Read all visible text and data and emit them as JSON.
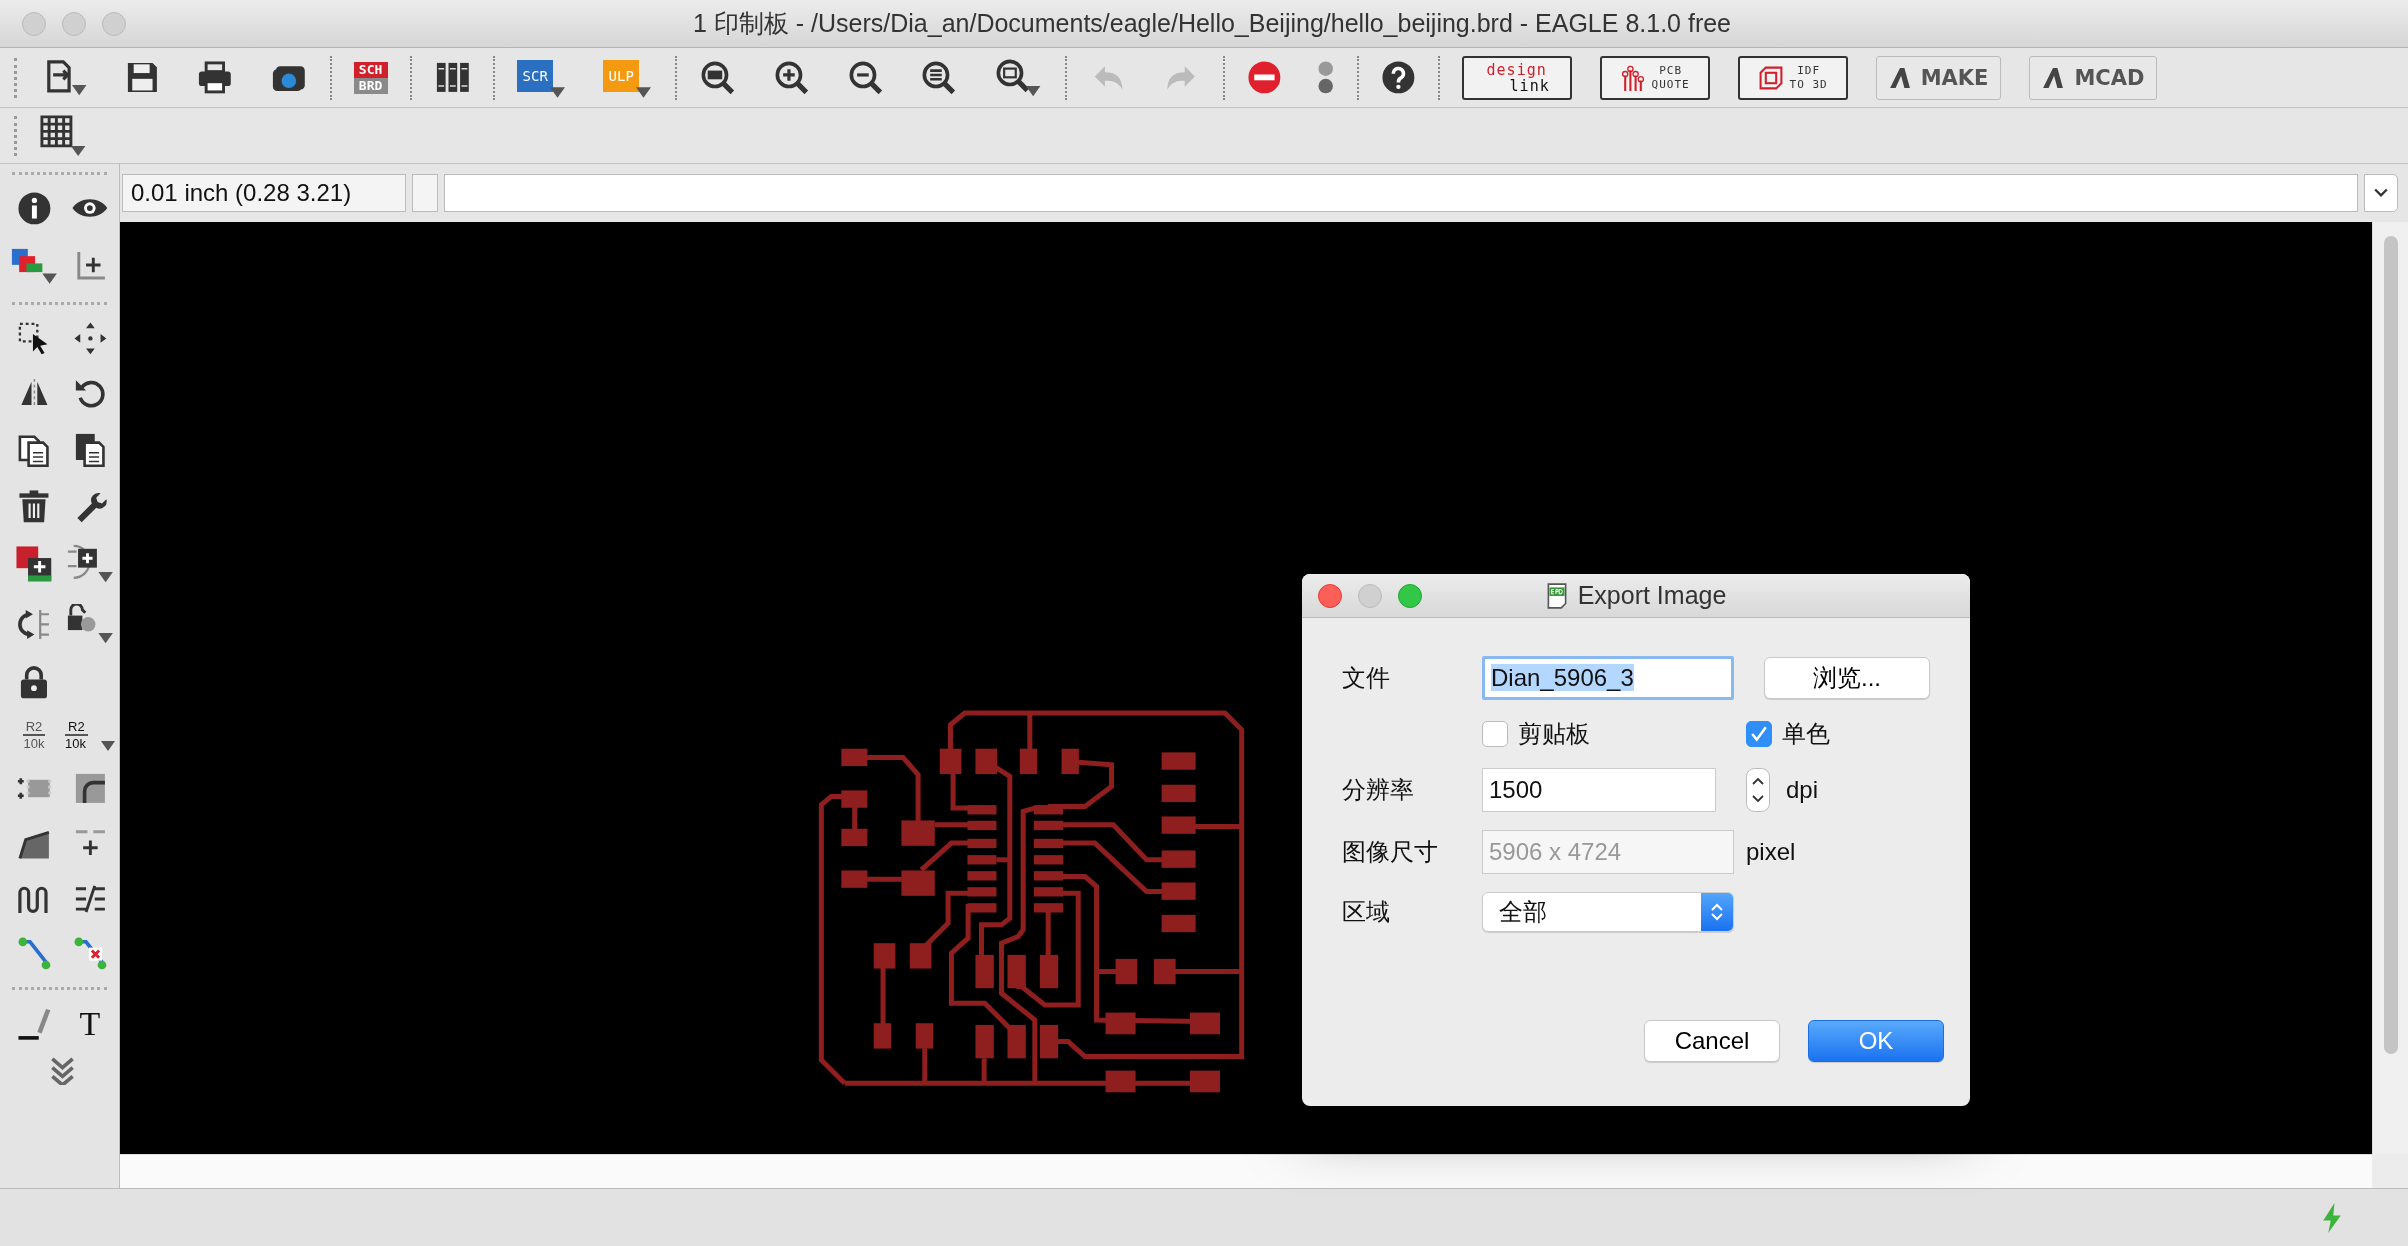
{
  "window": {
    "title": "1 印制板 - /Users/Dia_an/Documents/eagle/Hello_Beijing/hello_beijing.brd - EAGLE 8.1.0 free"
  },
  "toolbar": [
    [
      {
        "kind": "open"
      },
      {
        "kind": "save"
      },
      {
        "kind": "print"
      },
      {
        "kind": "camera"
      }
    ],
    [
      {
        "kind": "sch-brd",
        "lines": [
          "SCH",
          "BRD"
        ]
      }
    ],
    [
      {
        "kind": "library"
      }
    ],
    [
      {
        "kind": "script",
        "lines": [
          "SCR"
        ]
      },
      {
        "kind": "ulp",
        "lines": [
          "ULP"
        ]
      }
    ],
    [
      {
        "kind": "zoom-fit"
      },
      {
        "kind": "zoom-in"
      },
      {
        "kind": "zoom-out"
      },
      {
        "kind": "zoom-redraw"
      },
      {
        "kind": "zoom-select"
      }
    ],
    [
      {
        "kind": "undo",
        "disabled": true
      },
      {
        "kind": "redo",
        "disabled": true
      }
    ],
    [
      {
        "kind": "stop"
      },
      {
        "kind": "go"
      }
    ],
    [
      {
        "kind": "help"
      }
    ],
    [
      {
        "kind": "design-link",
        "lines": [
          "design",
          "link"
        ]
      },
      {
        "kind": "pcb-quote",
        "lines": [
          "PCB",
          "QUOTE"
        ]
      },
      {
        "kind": "idf",
        "lines": [
          "IDF",
          "TO 3D"
        ]
      },
      {
        "kind": "make",
        "lines": [
          "MAKE"
        ]
      },
      {
        "kind": "mcad",
        "lines": [
          "MCAD"
        ]
      }
    ]
  ],
  "toolbar2": [
    {
      "kind": "grid"
    }
  ],
  "command_row": {
    "coordinates": "0.01 inch (0.28 3.21)"
  },
  "sidebar": [
    [
      {
        "kind": "info"
      },
      {
        "kind": "eye"
      },
      {
        "kind": "layers"
      },
      {
        "kind": "mark"
      }
    ],
    [
      {
        "kind": "select"
      },
      {
        "kind": "move"
      },
      {
        "kind": "mirror"
      },
      {
        "kind": "rotate"
      },
      {
        "kind": "copy"
      },
      {
        "kind": "paste"
      },
      {
        "kind": "delete"
      },
      {
        "kind": "wrench"
      },
      {
        "kind": "add"
      },
      {
        "kind": "replace"
      },
      {
        "kind": "swap"
      },
      {
        "kind": "smash"
      },
      {
        "kind": "lock"
      },
      {
        "kind": "empty"
      },
      {
        "kind": "name",
        "lines": [
          "R2",
          "10k"
        ]
      },
      {
        "kind": "value",
        "lines": [
          "R2",
          "10k"
        ]
      },
      {
        "kind": "pinswap"
      },
      {
        "kind": "arc"
      },
      {
        "kind": "miter"
      },
      {
        "kind": "split"
      },
      {
        "kind": "meander"
      },
      {
        "kind": "optimize"
      },
      {
        "kind": "route"
      },
      {
        "kind": "ripup"
      }
    ],
    [
      {
        "kind": "line"
      },
      {
        "kind": "text",
        "lines": [
          "T"
        ]
      },
      {
        "kind": "more"
      }
    ]
  ],
  "dialog": {
    "title": "Export Image",
    "file": {
      "label": "文件",
      "value": "Dian_5906_3",
      "text_selected": true
    },
    "browse": "浏览...",
    "options": [
      {
        "label": "剪贴板",
        "checked": false
      },
      {
        "label": "单色",
        "checked": true
      }
    ],
    "resolution": {
      "label": "分辨率",
      "value": "1500",
      "unit": "dpi"
    },
    "image_size": {
      "label": "图像尺寸",
      "value": "5906 x 4724",
      "unit": "pixel",
      "disabled": true
    },
    "area": {
      "label": "区域",
      "value": "全部"
    },
    "buttons": [
      {
        "label": "Cancel",
        "default": false
      },
      {
        "label": "OK",
        "default": true
      }
    ]
  }
}
